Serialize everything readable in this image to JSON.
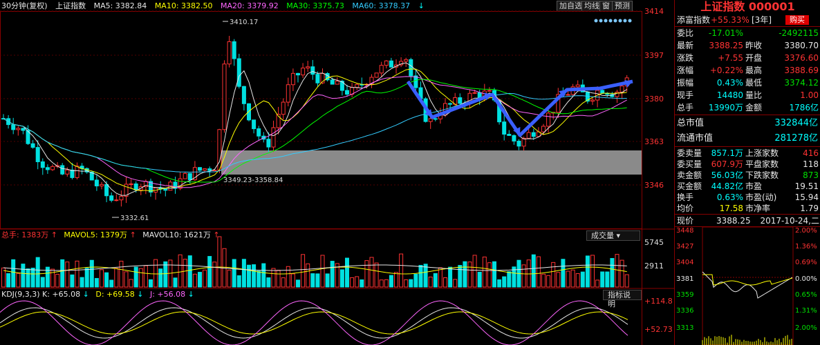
{
  "header": {
    "period": "30分钟(复权)",
    "symbol": "上证指数",
    "ma5": "MA5: 3382.84",
    "ma10": "MA10: 3382.50",
    "ma20": "MA20: 3379.92",
    "ma30": "MA30: 3375.73",
    "ma60": "MA60: 3378.37",
    "arrow_down": "↓",
    "buttons": [
      "加自选",
      "均线",
      "窗",
      "预测"
    ]
  },
  "price_axis": [
    "3414",
    "3397",
    "3380",
    "3363",
    "3346"
  ],
  "annotations": {
    "high": "3410.17",
    "low": "3332.61",
    "gap": "3349.23-3358.84"
  },
  "volume_bar": {
    "total": "总手: 1383万",
    "mavol5": "MAVOL5: 1379万",
    "mavol10": "MAVOL10: 1621万",
    "button": "成交量",
    "axis": [
      "5745",
      "2911"
    ]
  },
  "kdj_bar": {
    "name": "KDJ(9,3,3)",
    "k": "K: +65.08",
    "d": "D: +69.58",
    "j": "J: +56.08",
    "button": "指标说明",
    "axis": [
      "+114.8",
      "+52.73"
    ]
  },
  "side": {
    "title": "上证指数 000001",
    "sub_name": "添富指数",
    "sub_change": "+55.33%",
    "sub_period": "[3年]",
    "buy": "购买",
    "rows": [
      {
        "l1": "委比",
        "v1": "-17.01%",
        "v1c": "green",
        "l2": "",
        "v2": "-2492115",
        "v2c": "green"
      },
      {
        "l1": "最新",
        "v1": "3388.25",
        "v1c": "red",
        "l2": "昨收",
        "v2": "3380.70",
        "v2c": "white"
      },
      {
        "l1": "涨跌",
        "v1": "+7.55",
        "v1c": "red",
        "l2": "开盘",
        "v2": "3376.60",
        "v2c": "red"
      },
      {
        "l1": "涨幅",
        "v1": "+0.22%",
        "v1c": "red",
        "l2": "最高",
        "v2": "3388.69",
        "v2c": "red"
      },
      {
        "l1": "振幅",
        "v1": "0.43%",
        "v1c": "cyan",
        "l2": "最低",
        "v2": "3374.12",
        "v2c": "green"
      },
      {
        "l1": "现手",
        "v1": "14480",
        "v1c": "cyan",
        "l2": "量比",
        "v2": "1.00",
        "v2c": "red"
      },
      {
        "l1": "总手",
        "v1": "13990万",
        "v1c": "cyan",
        "l2": "金额",
        "v2": "1786亿",
        "v2c": "cyan"
      }
    ],
    "total_mv_label": "总市值",
    "total_mv": "332844亿",
    "float_mv_label": "流通市值",
    "float_mv": "281278亿",
    "rows2": [
      {
        "l1": "委卖量",
        "v1": "857.1万",
        "v1c": "cyan",
        "l2": "上涨家数",
        "v2": "416",
        "v2c": "red"
      },
      {
        "l1": "委买量",
        "v1": "607.9万",
        "v1c": "red",
        "l2": "平盘家数",
        "v2": "118",
        "v2c": "white"
      },
      {
        "l1": "卖金额",
        "v1": "56.03亿",
        "v1c": "cyan",
        "l2": "下跌家数",
        "v2": "873",
        "v2c": "green"
      },
      {
        "l1": "买金额",
        "v1": "44.82亿",
        "v1c": "cyan",
        "l2": "市盈",
        "v2": "19.51",
        "v2c": "white"
      },
      {
        "l1": "换手",
        "v1": "0.63%",
        "v1c": "cyan",
        "l2": "市盈(动)",
        "v2": "15.94",
        "v2c": "white"
      },
      {
        "l1": "均价",
        "v1": "17.58",
        "v1c": "yellow",
        "l2": "市净率",
        "v2": "1.79",
        "v2c": "white"
      }
    ],
    "now_label": "现价",
    "now_value": "3388.25",
    "date": "2017-10-24,二",
    "mini_axis_left": [
      "3448",
      "3427",
      "3404",
      "3381",
      "3359",
      "3336",
      "3313"
    ],
    "mini_axis_right": [
      "2.00%",
      "1.36%",
      "0.69%",
      "0.00%",
      "0.65%",
      "1.31%",
      "2.00%"
    ]
  }
}
